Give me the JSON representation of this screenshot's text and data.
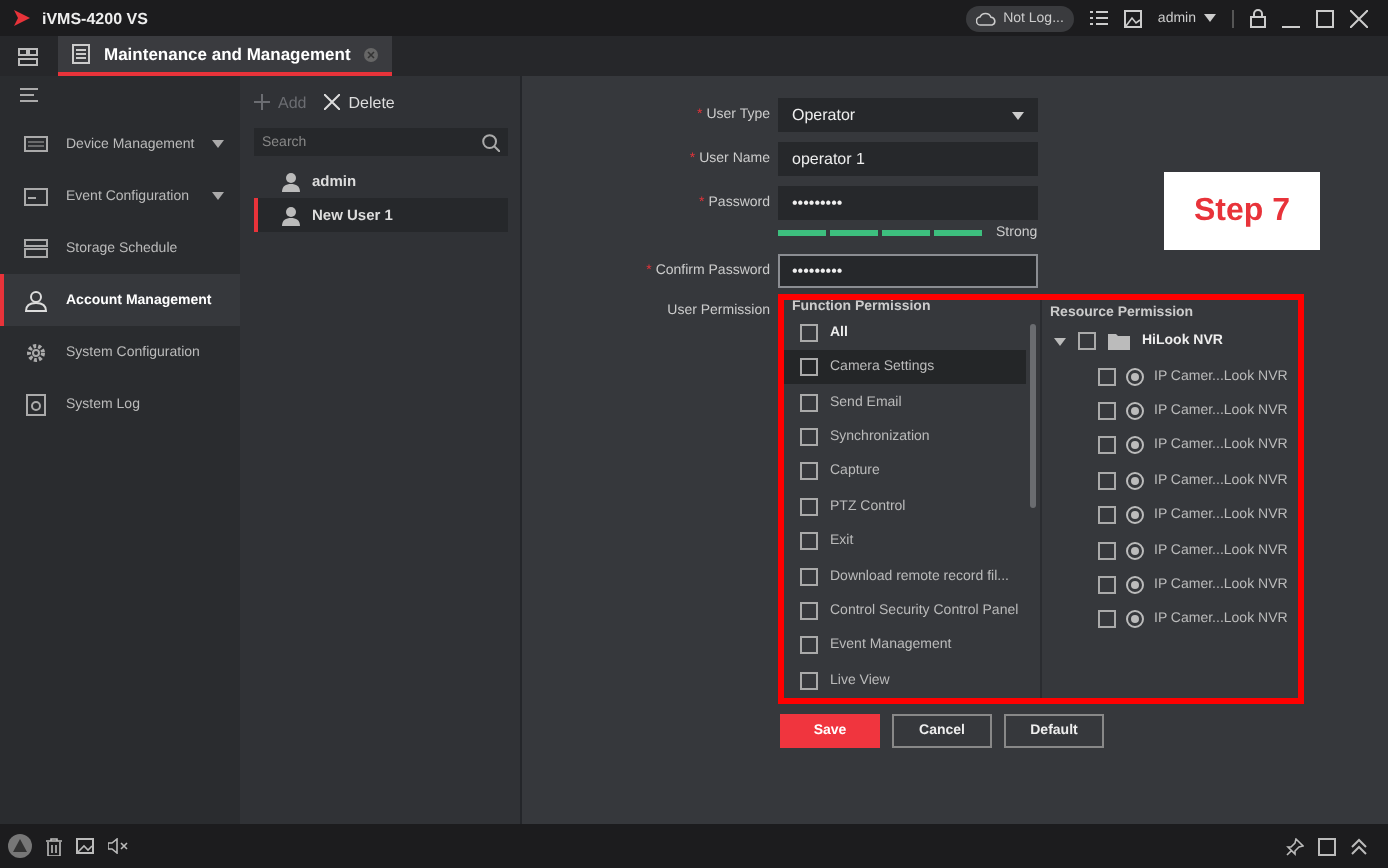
{
  "window": {
    "title": "iVMS-4200 VS",
    "account_status": "Not Log...",
    "user": "admin"
  },
  "tabs": [
    {
      "label": "Maintenance and Management",
      "selected": true
    }
  ],
  "sidebar": {
    "items": [
      {
        "label": "Device Management",
        "expandable": true,
        "selected": false
      },
      {
        "label": "Event Configuration",
        "expandable": true,
        "selected": false
      },
      {
        "label": "Storage Schedule",
        "expandable": false,
        "selected": false
      },
      {
        "label": "Account Management",
        "expandable": false,
        "selected": true
      },
      {
        "label": "System Configuration",
        "expandable": false,
        "selected": false
      },
      {
        "label": "System Log",
        "expandable": false,
        "selected": false
      }
    ]
  },
  "user_list": {
    "add": "Add",
    "delete": "Delete",
    "add_disabled": true,
    "search": {
      "placeholder": "Search"
    },
    "users": [
      {
        "name": "admin",
        "selected": false
      },
      {
        "name": "New User 1",
        "selected": true
      }
    ]
  },
  "form": {
    "fields": [
      {
        "kind": "select",
        "required_mark": "*",
        "label": "User Type",
        "value": "Operator"
      },
      {
        "kind": "text",
        "required_mark": "*",
        "label": "User Name",
        "value": "operator 1"
      },
      {
        "kind": "password",
        "required_mark": "*",
        "label": "Password",
        "value": "•••••••••"
      },
      {
        "kind": "strength",
        "level": 1.0,
        "reading": "Strong"
      },
      {
        "kind": "password",
        "required_mark": "*",
        "label": "Confirm Password",
        "value": "•••••••••",
        "focused": true
      }
    ],
    "permission_label": "User Permission",
    "function_permission": {
      "title": "Function Permission",
      "items": [
        {
          "label": "All",
          "checked": false,
          "selected": false,
          "bold": true
        },
        {
          "label": "Camera Settings",
          "checked": false,
          "selected": true,
          "bold": false
        },
        {
          "label": "Send Email",
          "checked": false,
          "selected": false,
          "bold": false
        },
        {
          "label": "Synchronization",
          "checked": false,
          "selected": false,
          "bold": false
        },
        {
          "label": "Capture",
          "checked": false,
          "selected": false,
          "bold": false
        },
        {
          "label": "PTZ Control",
          "checked": false,
          "selected": false,
          "bold": false
        },
        {
          "label": "Exit",
          "checked": false,
          "selected": false,
          "bold": false
        },
        {
          "label": "Download remote record fil...",
          "checked": false,
          "selected": false,
          "bold": false
        },
        {
          "label": "Control Security Control Panel",
          "checked": false,
          "selected": false,
          "bold": false
        },
        {
          "label": "Event Management",
          "checked": false,
          "selected": false,
          "bold": false
        },
        {
          "label": "Live View",
          "checked": false,
          "selected": false,
          "bold": false
        }
      ]
    },
    "resource_permission": {
      "title": "Resource Permission",
      "tree": [
        {
          "label": "HiLook NVR",
          "checked": false,
          "expanded": true,
          "children": [
            {
              "label": "IP Camer...Look NVR",
              "checked": false
            },
            {
              "label": "IP Camer...Look NVR",
              "checked": false
            },
            {
              "label": "IP Camer...Look NVR",
              "checked": false
            },
            {
              "label": "IP Camer...Look NVR",
              "checked": false
            },
            {
              "label": "IP Camer...Look NVR",
              "checked": false
            },
            {
              "label": "IP Camer...Look NVR",
              "checked": false
            },
            {
              "label": "IP Camer...Look NVR",
              "checked": false
            },
            {
              "label": "IP Camer...Look NVR",
              "checked": false
            }
          ]
        }
      ]
    },
    "buttons": [
      {
        "label": "Save",
        "kind": "primary"
      },
      {
        "label": "Cancel",
        "kind": "normal"
      },
      {
        "label": "Default",
        "kind": "normal"
      }
    ]
  },
  "annotation": {
    "label": "Step 7"
  }
}
